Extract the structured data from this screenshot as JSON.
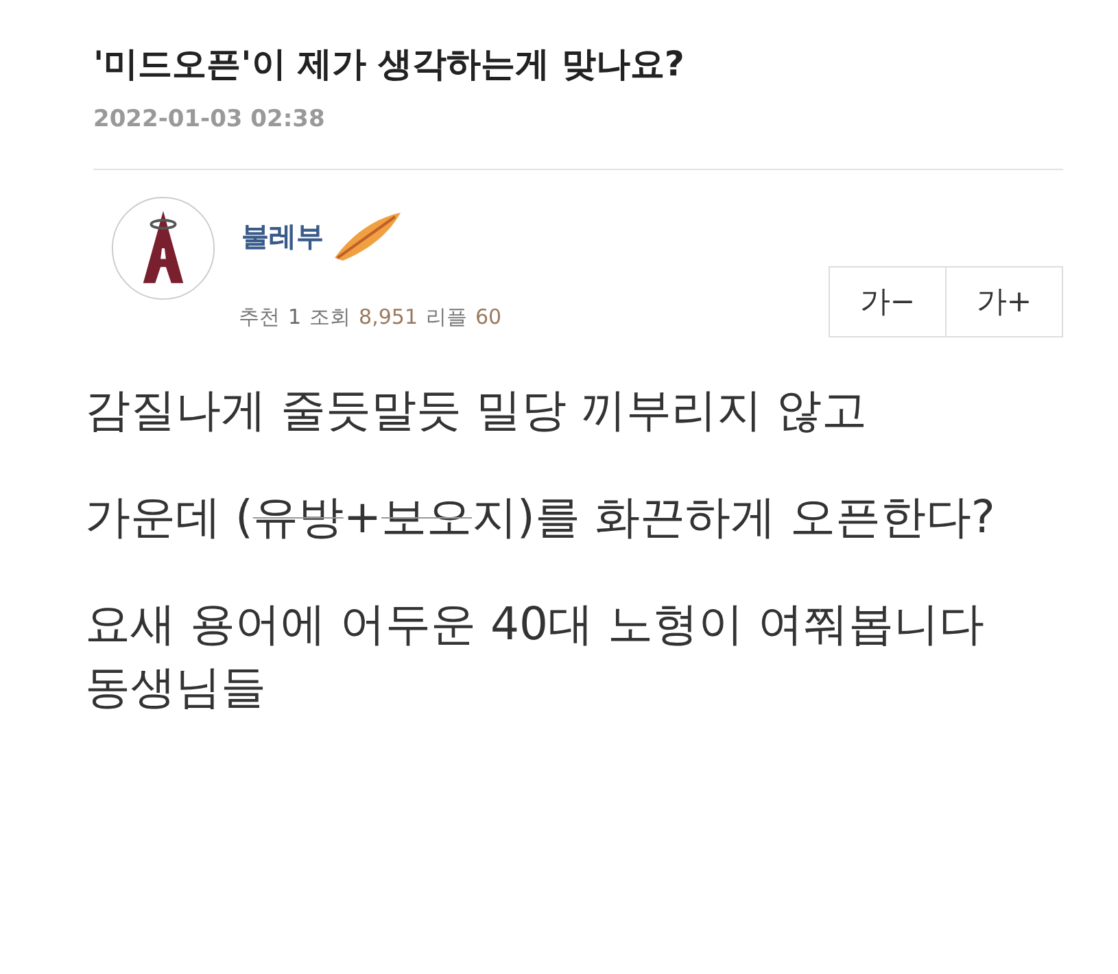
{
  "post": {
    "title": "'미드오픈'이 제가 생각하는게 맞나요?",
    "date": "2022-01-03 02:38"
  },
  "author": {
    "name": "불레부"
  },
  "stats": [
    {
      "label": "추천",
      "value": "1",
      "highlight": false
    },
    {
      "label": "조회",
      "value": "8,951",
      "highlight": true
    },
    {
      "label": "리플",
      "value": "60",
      "highlight": true
    }
  ],
  "font_buttons": [
    "가−",
    "가+"
  ],
  "body": [
    [
      {
        "text": "감질나게 줄듯말듯 밀당 끼부리지 않고",
        "struck": false
      }
    ],
    [
      {
        "text": "가운데 (",
        "struck": false
      },
      {
        "text": "유방",
        "struck": true
      },
      {
        "text": "+",
        "struck": false
      },
      {
        "text": "보오",
        "struck": true
      },
      {
        "text": "지)를 화끈하게 오픈한다?",
        "struck": false
      }
    ],
    [
      {
        "text": "요새 용어에 어두운 40대 노형이 여쭤봅니다 동생님들",
        "struck": false
      }
    ]
  ]
}
